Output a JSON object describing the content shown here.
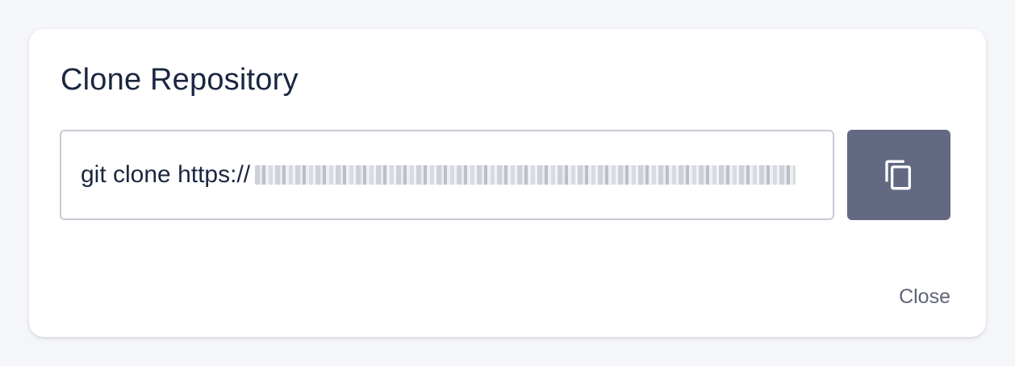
{
  "dialog": {
    "title": "Clone Repository",
    "clone_command_prefix": "git clone https://",
    "copy_icon": "copy-icon",
    "close_label": "Close"
  },
  "colors": {
    "copy_button_bg": "#636983",
    "title_text": "#1b2640",
    "close_text": "#5f6478"
  }
}
